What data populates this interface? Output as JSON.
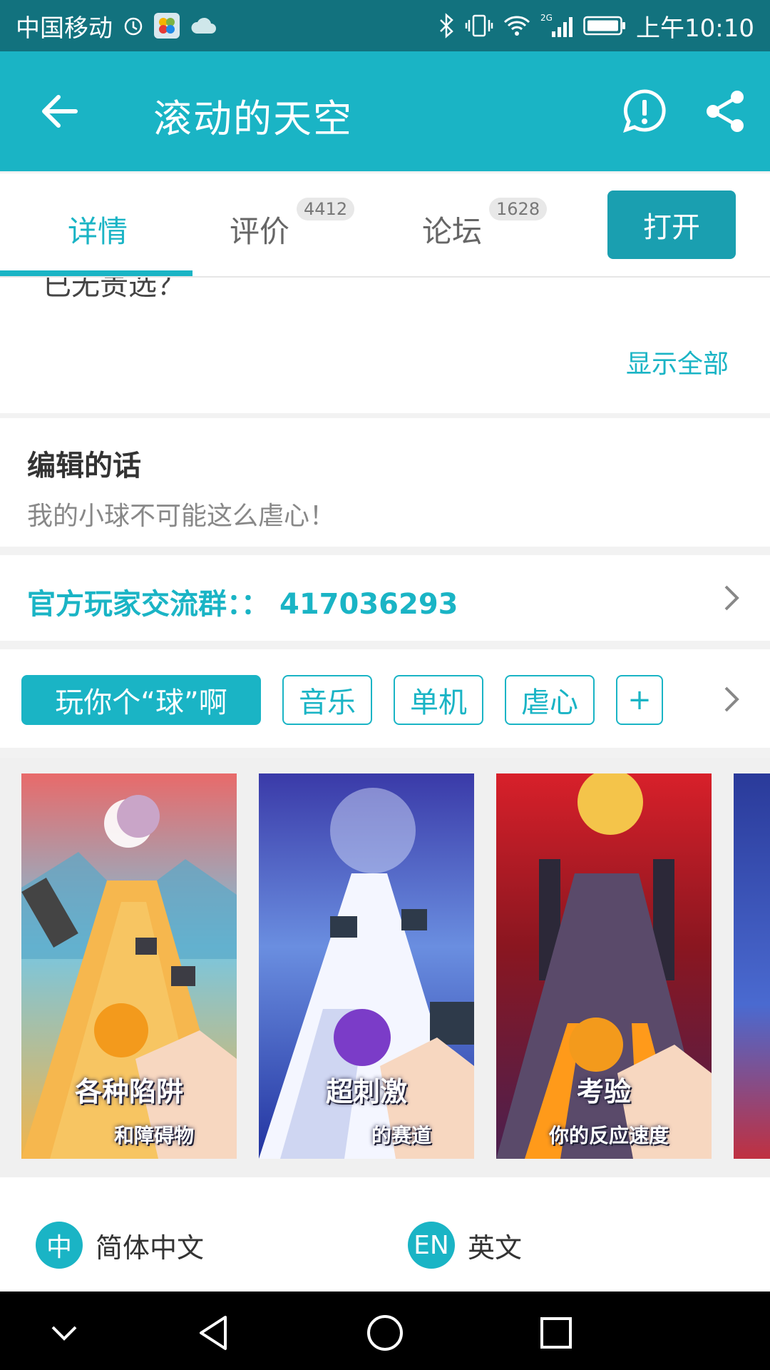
{
  "status_bar": {
    "carrier": "中国移动",
    "network": "2G",
    "time": "上午10:10",
    "icons": [
      "alarm-icon",
      "photos-app-icon",
      "cloud-icon",
      "bluetooth-icon",
      "vibrate-icon",
      "wifi-icon",
      "signal-icon",
      "battery-icon"
    ]
  },
  "app_bar": {
    "title": "滚动的天空",
    "icons": [
      "back-arrow-icon",
      "report-icon",
      "share-icon"
    ],
    "color": "#1ab4c5"
  },
  "tabs": [
    {
      "label": "详情",
      "count": "",
      "active": true
    },
    {
      "label": "评价",
      "count": "4412",
      "active": false
    },
    {
      "label": "论坛",
      "count": "1628",
      "active": false
    }
  ],
  "open_button": "打开",
  "description": {
    "cut_text": "已无贵选？",
    "show_all": "显示全部"
  },
  "editor": {
    "title": "编辑的话",
    "quote": "我的小球不可能这么虐心！"
  },
  "group": {
    "label": "官方玩家交流群：：",
    "number": "417036293"
  },
  "tags": [
    "玩你个“球”啊",
    "音乐",
    "单机",
    "虐心",
    "+"
  ],
  "screenshots": [
    {
      "caption": "各种陷阱",
      "sub": "和障碍物"
    },
    {
      "caption": "超刺激",
      "sub": "的赛道"
    },
    {
      "caption": "考验",
      "sub": "你的反应速度"
    }
  ],
  "languages": [
    {
      "badge": "中",
      "label": "简体中文"
    },
    {
      "badge": "EN",
      "label": "英文"
    }
  ],
  "nav_icons": [
    "collapse-icon",
    "back-triangle-icon",
    "home-circle-icon",
    "recents-square-icon"
  ]
}
